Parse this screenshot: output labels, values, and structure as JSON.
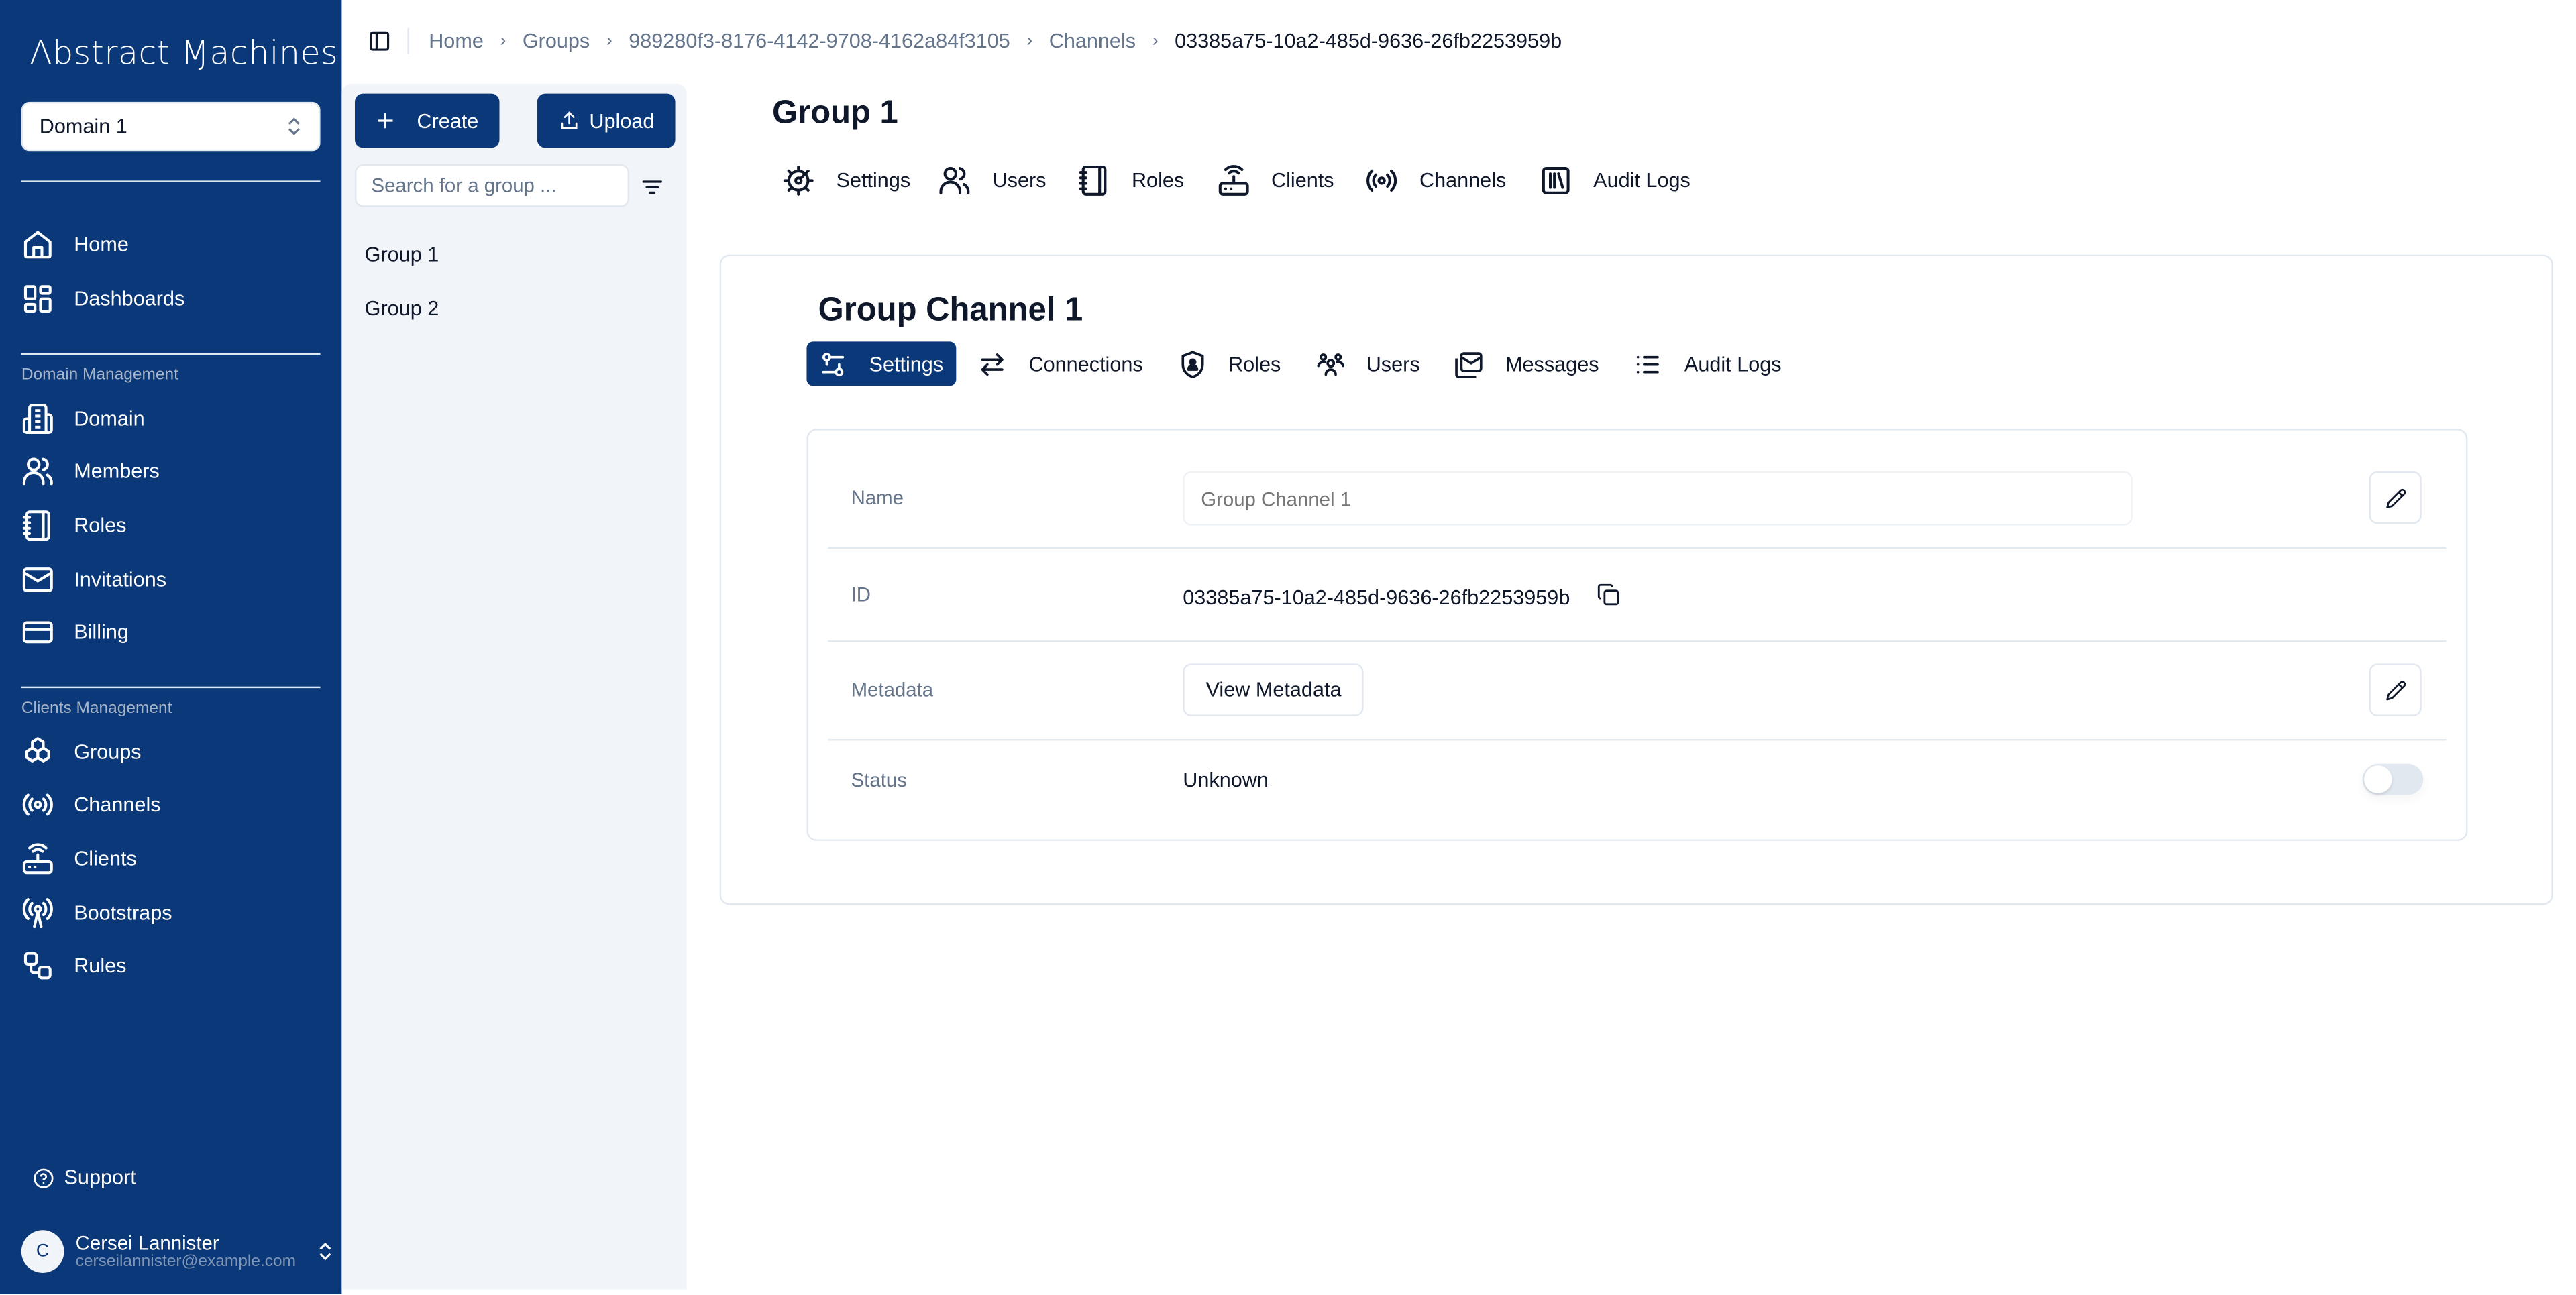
{
  "brand": {
    "logo_text": "Λbstract Ɱachines",
    "sidebar_color": "#0b3878"
  },
  "domain_selector": {
    "value": "Domain 1"
  },
  "sidebar": {
    "top_items": [
      {
        "label": "Home",
        "icon": "home-icon"
      },
      {
        "label": "Dashboards",
        "icon": "dashboard-icon"
      }
    ],
    "sections": [
      {
        "label": "Domain Management",
        "items": [
          {
            "label": "Domain",
            "icon": "building-icon"
          },
          {
            "label": "Members",
            "icon": "users-icon"
          },
          {
            "label": "Roles",
            "icon": "notebook-icon"
          },
          {
            "label": "Invitations",
            "icon": "mail-icon"
          },
          {
            "label": "Billing",
            "icon": "credit-card-icon"
          }
        ]
      },
      {
        "label": "Clients Management",
        "items": [
          {
            "label": "Groups",
            "icon": "boxes-icon"
          },
          {
            "label": "Channels",
            "icon": "broadcast-icon"
          },
          {
            "label": "Clients",
            "icon": "router-icon"
          },
          {
            "label": "Bootstraps",
            "icon": "antenna-icon"
          },
          {
            "label": "Rules",
            "icon": "workflow-icon"
          }
        ]
      }
    ],
    "support_label": "Support",
    "user": {
      "initial": "C",
      "name": "Cersei Lannister",
      "email": "cerseilannister@example.com"
    }
  },
  "breadcrumb": [
    {
      "label": "Home"
    },
    {
      "label": "Groups"
    },
    {
      "label": "989280f3-8176-4142-9708-4162a84f3105"
    },
    {
      "label": "Channels"
    },
    {
      "label": "03385a75-10a2-485d-9636-26fb2253959b"
    }
  ],
  "group_panel": {
    "create_label": "Create",
    "upload_label": "Upload",
    "search_placeholder": "Search for a group ...",
    "groups": [
      "Group 1",
      "Group 2"
    ]
  },
  "page": {
    "title": "Group 1",
    "tabs": [
      {
        "label": "Settings",
        "icon": "gear-icon"
      },
      {
        "label": "Users",
        "icon": "users-icon"
      },
      {
        "label": "Roles",
        "icon": "notebook-icon"
      },
      {
        "label": "Clients",
        "icon": "router-icon"
      },
      {
        "label": "Channels",
        "icon": "broadcast-icon"
      },
      {
        "label": "Audit Logs",
        "icon": "library-icon"
      }
    ]
  },
  "channel": {
    "title": "Group Channel 1",
    "tabs": [
      {
        "label": "Settings",
        "icon": "sliders-icon",
        "active": true
      },
      {
        "label": "Connections",
        "icon": "arrows-exchange-icon"
      },
      {
        "label": "Roles",
        "icon": "shield-user-icon"
      },
      {
        "label": "Users",
        "icon": "users-group-icon"
      },
      {
        "label": "Messages",
        "icon": "mail-inbox-icon"
      },
      {
        "label": "Audit Logs",
        "icon": "list-icon"
      }
    ],
    "fields": {
      "name_label": "Name",
      "name_placeholder": "Group Channel 1",
      "name_value": "",
      "id_label": "ID",
      "id_value": "03385a75-10a2-485d-9636-26fb2253959b",
      "metadata_label": "Metadata",
      "metadata_button": "View Metadata",
      "status_label": "Status",
      "status_value": "Unknown",
      "status_enabled": false
    }
  }
}
